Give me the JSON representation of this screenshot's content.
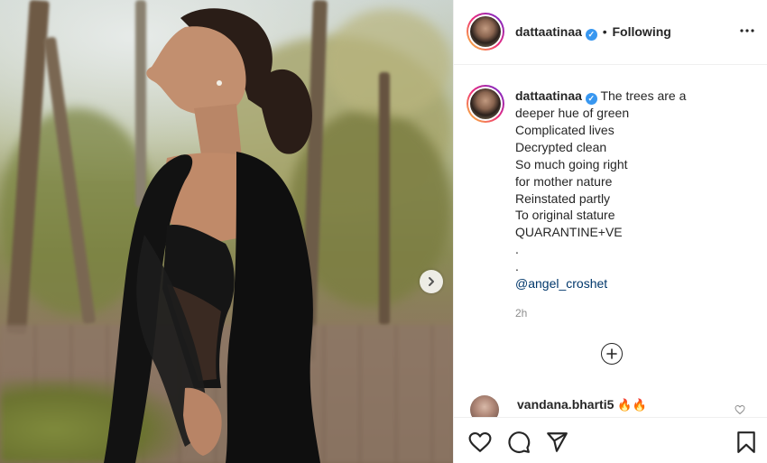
{
  "post": {
    "username": "dattaatinaa",
    "verified_mark": "✓",
    "separator": "•",
    "follow_status": "Following",
    "caption_lines": [
      "The trees are a",
      "deeper hue of green",
      "Complicated lives",
      "Decrypted clean",
      "So much going right",
      "for mother nature",
      "Reinstated partly",
      "To original stature",
      "QUARANTINE+VE",
      ".",
      "."
    ],
    "mention": "@angel_croshet",
    "timestamp": "2h"
  },
  "comments": [
    {
      "username": "vandana.bharti5",
      "text": "🔥🔥"
    }
  ],
  "icons": {
    "more": "more-options-icon",
    "next": "chevron-right-icon",
    "load_more": "plus-circle-icon",
    "like": "heart-icon",
    "comment": "comment-bubble-icon",
    "share": "paper-plane-icon",
    "save": "bookmark-icon"
  },
  "colors": {
    "verified": "#3897f0",
    "mention": "#00376b",
    "timestamp": "#8e8e8e",
    "story_ring_start": "#f9ce34",
    "story_ring_end": "#6228d7"
  }
}
